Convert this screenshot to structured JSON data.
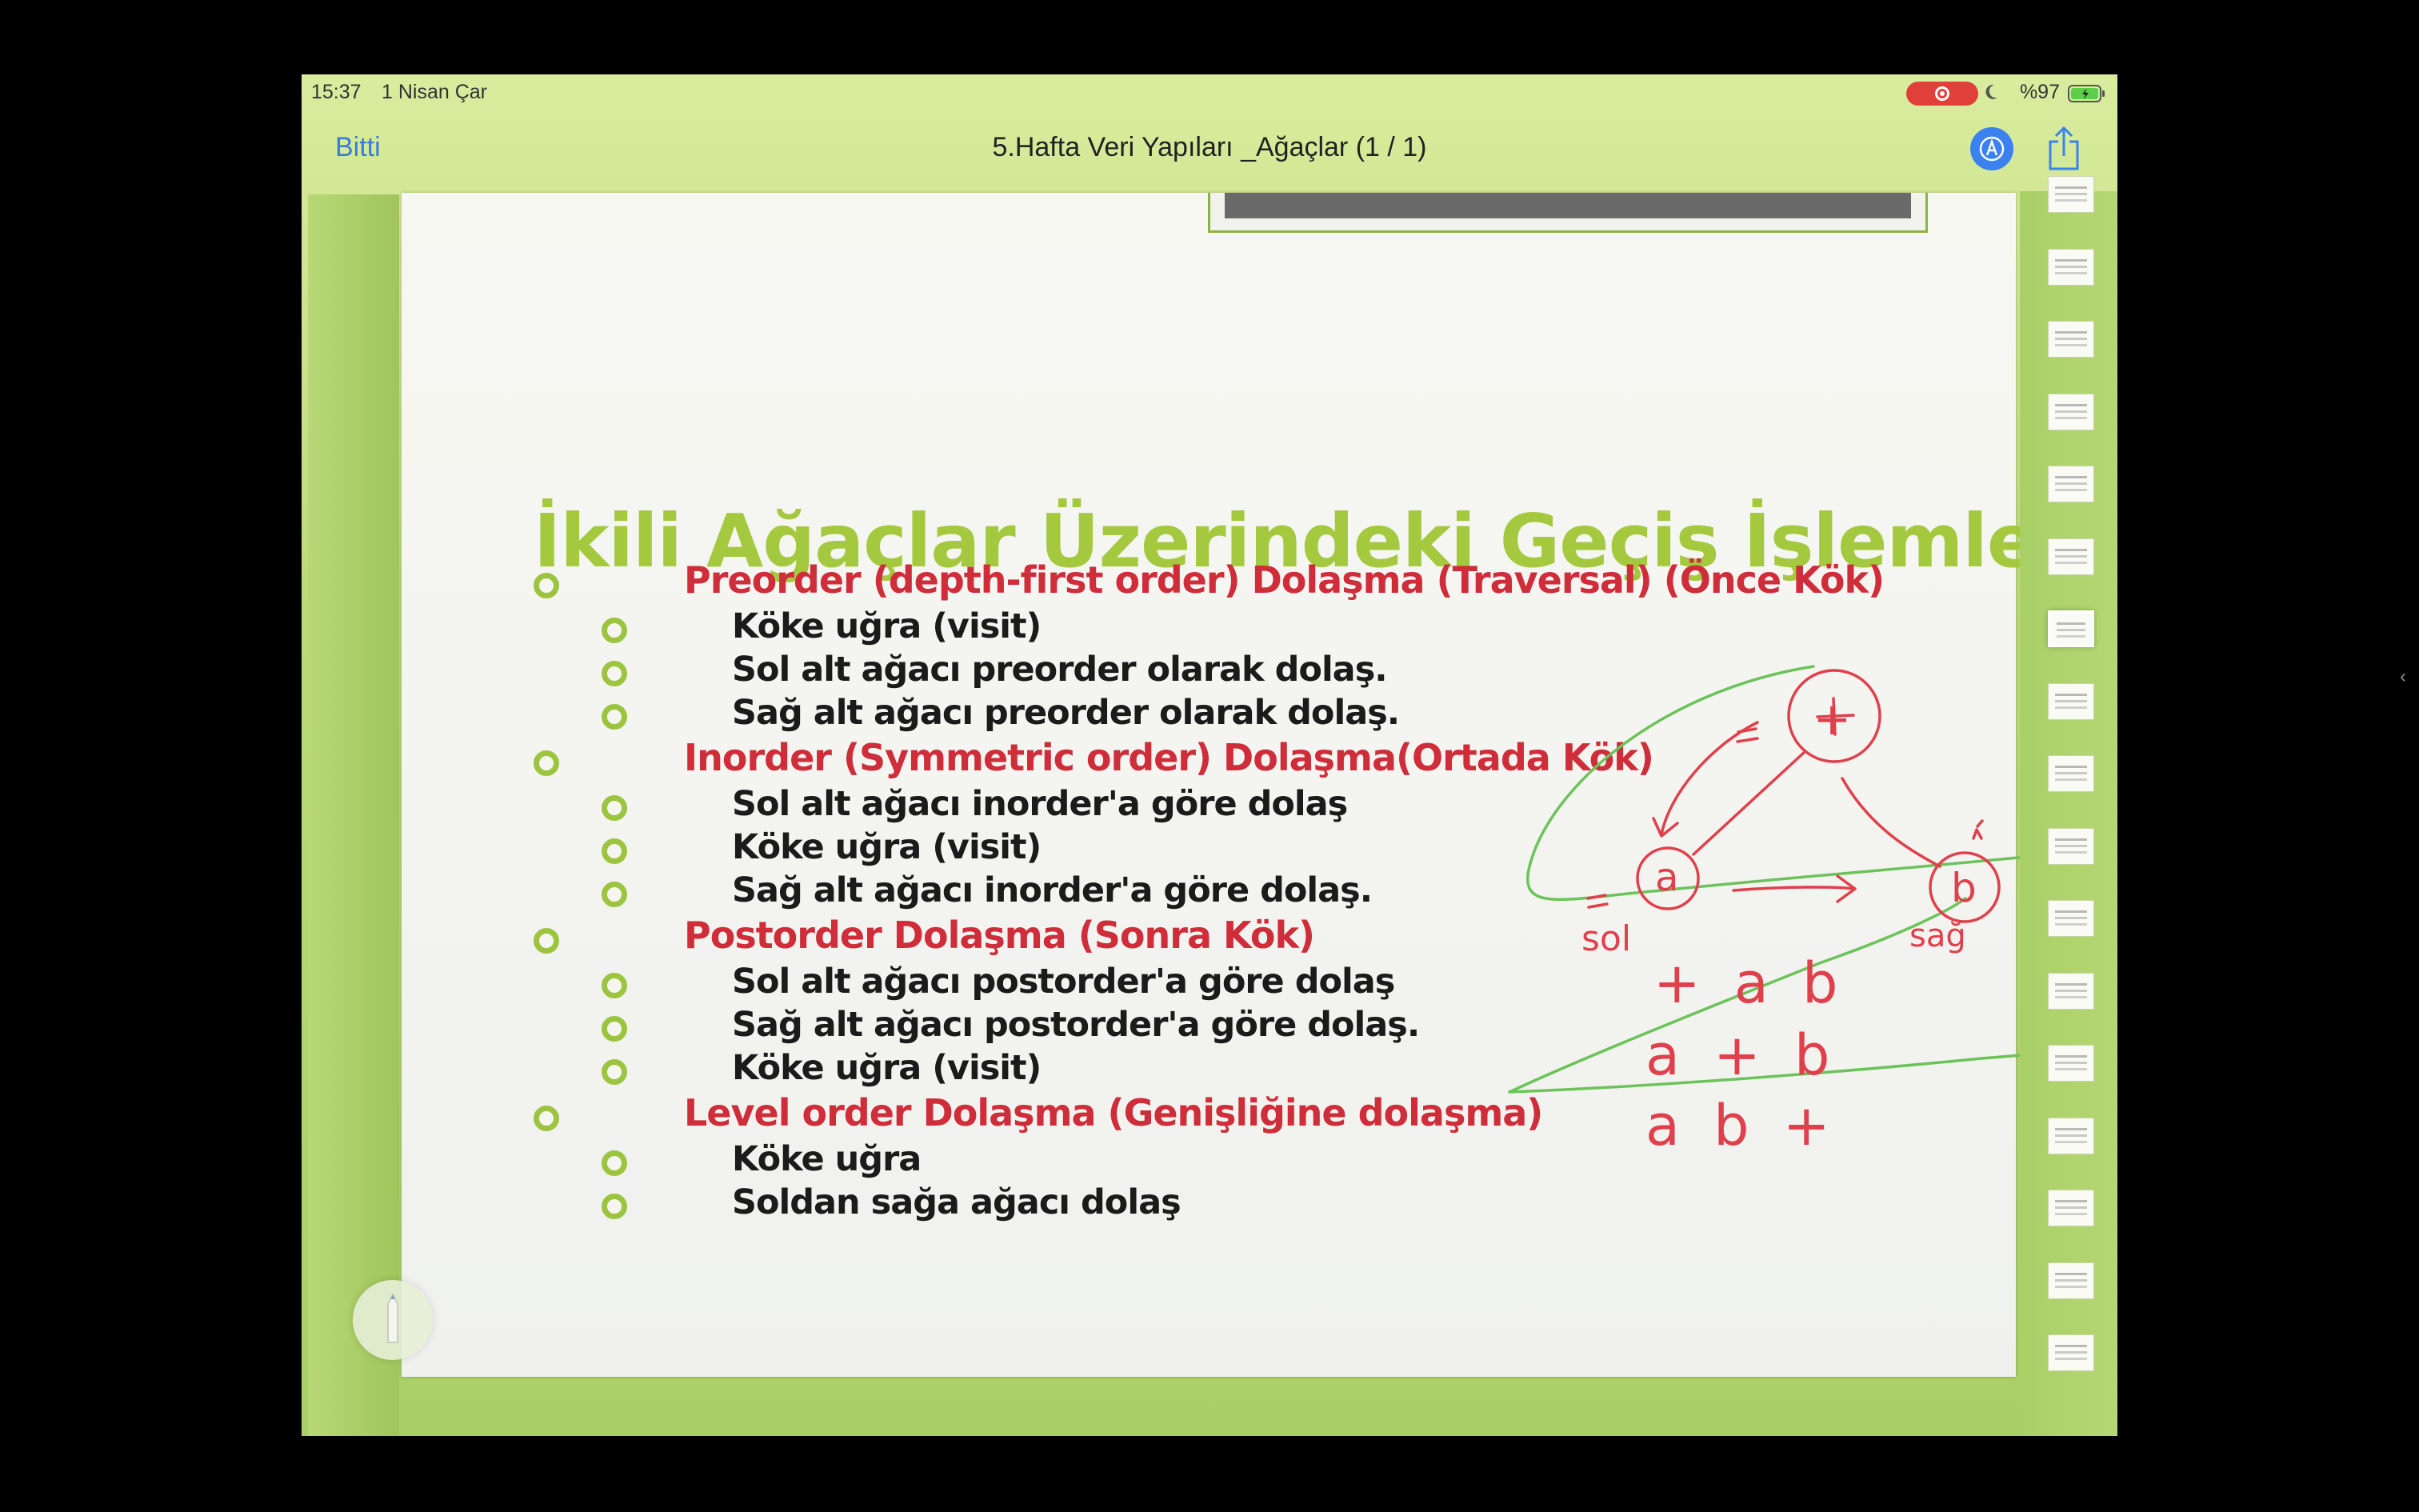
{
  "status_bar": {
    "time": "15:37",
    "date": "1 Nisan Çar",
    "battery": "%97"
  },
  "nav": {
    "done": "Bitti",
    "title": "5.Hafta Veri Yapıları _Ağaçlar (1 / 1)"
  },
  "slide": {
    "title": "İkili Ağaçlar Üzerindeki Geçiş İşlemleri",
    "sections": [
      {
        "heading": "Preorder (depth-first order) Dolaşma (Traversal) (Önce Kök)",
        "items": [
          "Köke uğra (visit)",
          "Sol alt ağacı preorder olarak dolaş.",
          "Sağ alt ağacı preorder olarak dolaş."
        ]
      },
      {
        "heading": "Inorder (Symmetric order) Dolaşma(Ortada Kök)",
        "items": [
          "Sol alt ağacı inorder'a göre dolaş",
          "Köke uğra (visit)",
          "Sağ alt ağacı inorder'a göre dolaş."
        ]
      },
      {
        "heading": "Postorder Dolaşma (Sonra Kök)",
        "items": [
          "Sol alt ağacı postorder'a göre dolaş",
          "Sağ alt ağacı postorder'a göre dolaş.",
          "Köke uğra (visit)"
        ]
      },
      {
        "heading": "Level order Dolaşma (Genişliğine dolaşma)",
        "items": [
          "Köke uğra",
          "Soldan sağa ağacı dolaş"
        ]
      }
    ]
  },
  "annotation": {
    "root": "+",
    "left_node": "a",
    "right_node": "b",
    "left_label": "sol",
    "right_label": "sağ",
    "preorder": "+ a b",
    "inorder": "a + b",
    "postorder": "a b +"
  },
  "thumbnails_count": 17,
  "icons": {
    "markup": "markup-pen-icon",
    "share": "share-icon",
    "pencil": "pencil-tool-icon",
    "record": "record-icon"
  }
}
